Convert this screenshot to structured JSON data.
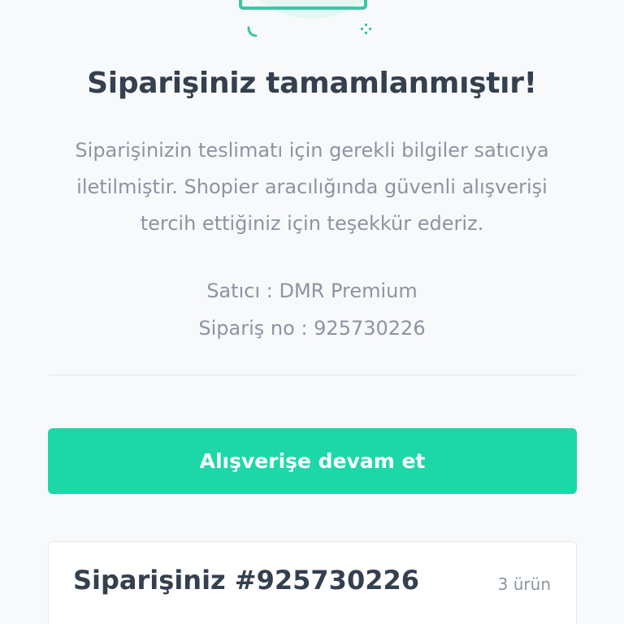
{
  "confirmation": {
    "title": "Siparişiniz tamamlanmıştır!",
    "description": "Siparişinizin teslimatı için gerekli bilgiler satıcıya iletilmiştir. Shopier aracılığında güvenli alışverişi tercih ettiğiniz için teşekkür ederiz.",
    "seller_line": "Satıcı : DMR Premium",
    "order_no_line": "Sipariş no : 925730226"
  },
  "actions": {
    "continue_shopping_label": "Alışverişe devam et"
  },
  "order_summary": {
    "title": "Siparişiniz #925730226",
    "item_count": "3 ürün"
  },
  "colors": {
    "accent": "#1dd7a9",
    "title_text": "#34404e",
    "muted_text": "#8b95a1",
    "illustration_teal": "#3cc7a4"
  },
  "icons": [
    "success-illustration",
    "sparkle-icon"
  ]
}
